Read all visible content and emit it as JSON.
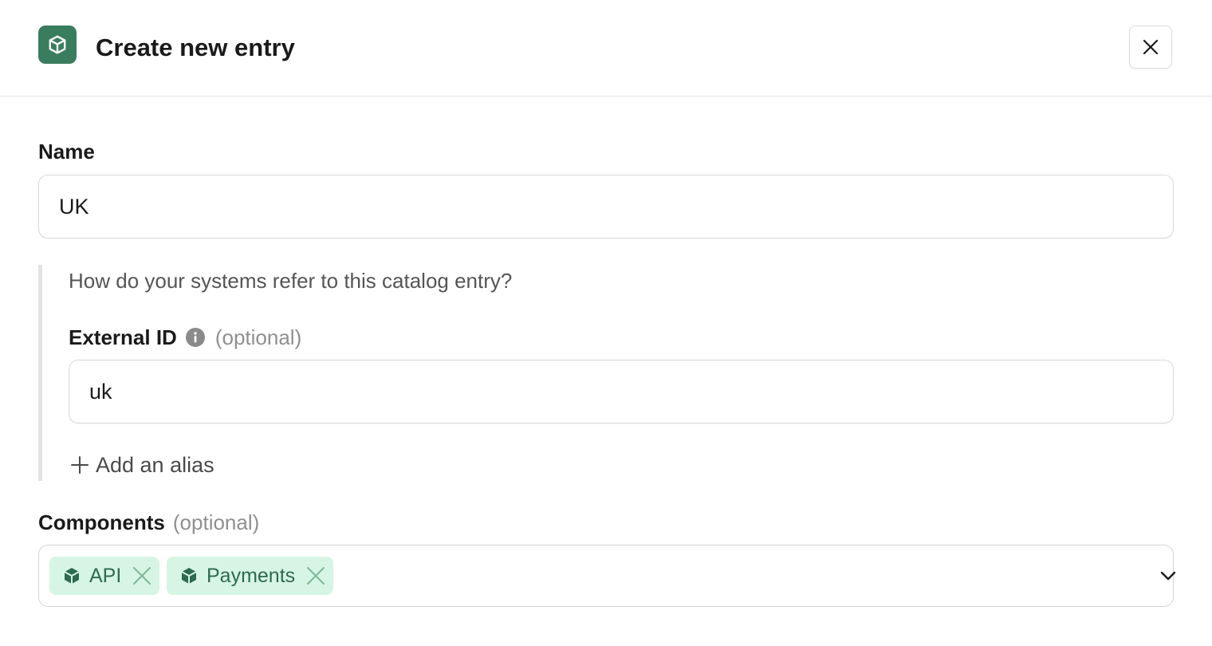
{
  "header": {
    "title": "Create new entry",
    "app_icon": "cube-icon",
    "close_icon": "close-icon"
  },
  "name_field": {
    "label": "Name",
    "value": "UK"
  },
  "alias_section": {
    "hint": "How do your systems refer to this catalog entry?",
    "external_id": {
      "label": "External ID",
      "optional": "(optional)",
      "info_icon": "info-icon",
      "value": "uk"
    },
    "add_alias_label": "Add an alias"
  },
  "components": {
    "label": "Components",
    "optional": "(optional)",
    "chips": [
      {
        "label": "API",
        "icon": "cube-icon"
      },
      {
        "label": "Payments",
        "icon": "cube-icon"
      }
    ],
    "dropdown_icon": "chevron-down-icon"
  },
  "colors": {
    "brand": "#3a7d5e",
    "chip_bg": "#d7f5e4",
    "chip_text": "#2e6b4e"
  }
}
